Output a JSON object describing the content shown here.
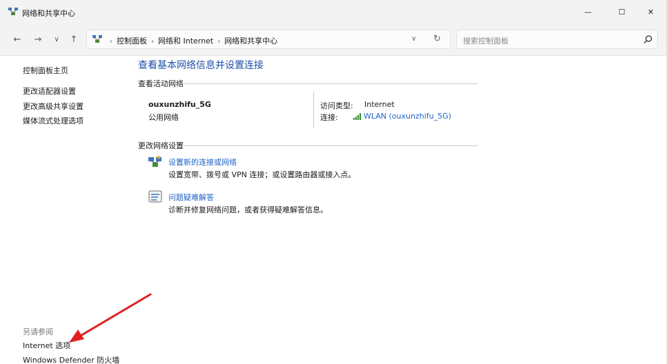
{
  "window": {
    "title": "网络和共享中心",
    "controls": {
      "minimize": "—",
      "maximize": "☐",
      "close": "✕"
    }
  },
  "addressbar": {
    "back": "←",
    "forward": "→",
    "recent": "∨",
    "up": "↑",
    "breadcrumbs": [
      "控制面板",
      "网络和 Internet",
      "网络和共享中心"
    ],
    "dropdown": "∨",
    "refresh": "↻",
    "search_placeholder": "搜索控制面板"
  },
  "sidebar": {
    "home": "控制面板主页",
    "links": [
      "更改适配器设置",
      "更改高级共享设置",
      "媒体流式处理选项"
    ],
    "see_also_title": "另请参阅",
    "see_also": [
      "Internet 选项",
      "Windows Defender 防火墙"
    ]
  },
  "main": {
    "title": "查看基本网络信息并设置连接",
    "active_networks_label": "查看活动网络",
    "network": {
      "name": "ouxunzhifu_5G",
      "category": "公用网络",
      "access_type_label": "访问类型:",
      "access_type_value": "Internet",
      "connection_label": "连接:",
      "connection_value": "WLAN (ouxunzhifu_5G)"
    },
    "change_settings_label": "更改网络设置",
    "tasks": [
      {
        "title": "设置新的连接或网络",
        "desc": "设置宽带、拨号或 VPN 连接；或设置路由器或接入点。"
      },
      {
        "title": "问题疑难解答",
        "desc": "诊断并修复网络问题，或者获得疑难解答信息。"
      }
    ]
  },
  "colors": {
    "accent_link": "#1f63c6",
    "title_blue": "#1f4fa8",
    "annotation_arrow": "#e02020",
    "wifi_green": "#2e8b2e"
  },
  "icons": [
    "network-center-icon",
    "back-icon",
    "forward-icon",
    "recent-dropdown-icon",
    "up-icon",
    "address-dropdown-icon",
    "refresh-icon",
    "search-icon",
    "wifi-signal-icon",
    "new-connection-icon",
    "troubleshoot-icon"
  ]
}
